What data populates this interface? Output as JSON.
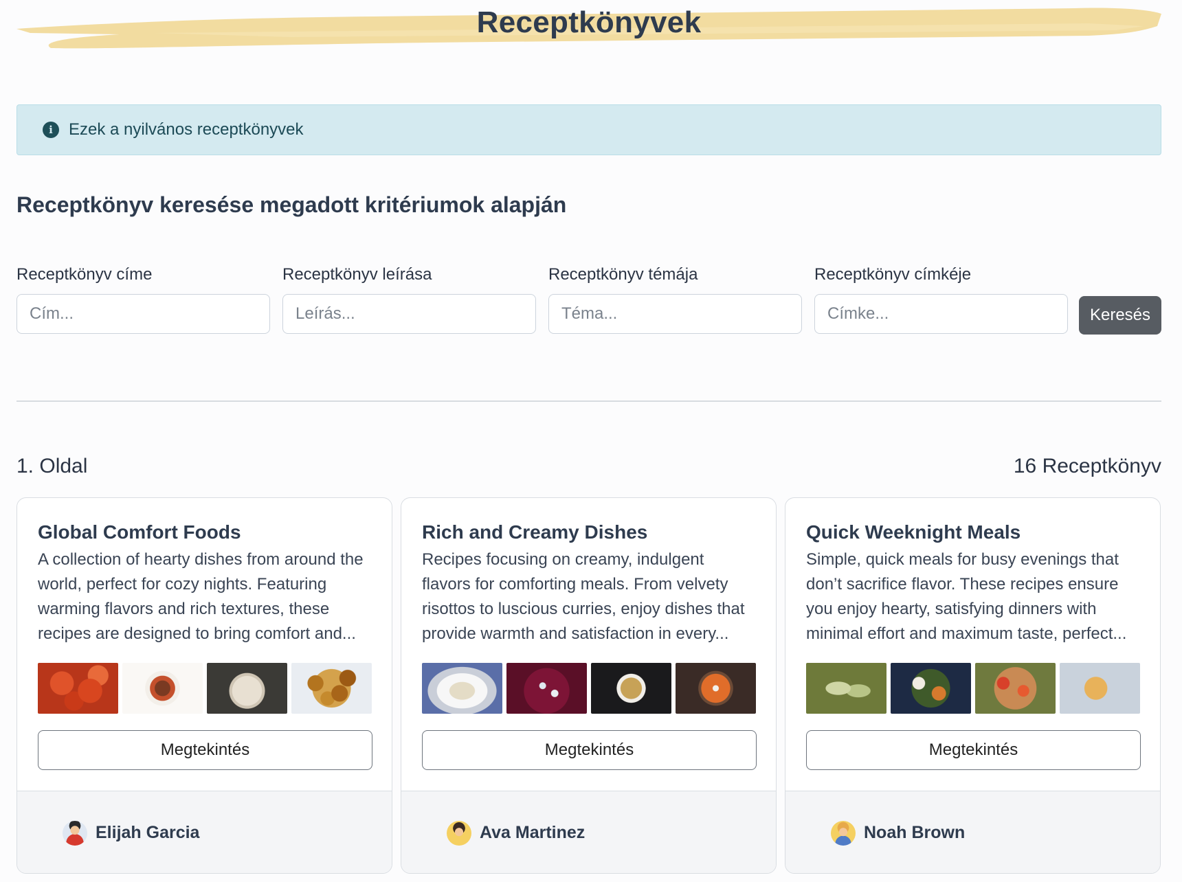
{
  "page": {
    "title": "Receptkönyvek"
  },
  "alert": {
    "text": "Ezek a nyilvános receptkönyvek",
    "icon": "info-icon"
  },
  "search": {
    "heading": "Receptkönyv keresése megadott kritériumok alapján",
    "fields": [
      {
        "label": "Receptkönyv címe",
        "placeholder": "Cím...",
        "value": ""
      },
      {
        "label": "Receptkönyv leírása",
        "placeholder": "Leírás...",
        "value": ""
      },
      {
        "label": "Receptkönyv témája",
        "placeholder": "Téma...",
        "value": ""
      },
      {
        "label": "Receptkönyv címkéje",
        "placeholder": "Címke...",
        "value": ""
      }
    ],
    "button_label": "Keresés"
  },
  "results": {
    "page_label": "1. Oldal",
    "count_label": "16 Receptkönyv"
  },
  "cards": [
    {
      "title": "Global Comfort Foods",
      "description": "A collection of hearty dishes from around the world, perfect for cozy nights. Featuring warming flavors and rich textures, these recipes are designed to bring comfort and...",
      "button_label": "Megtekintés",
      "author": "Elijah Garcia"
    },
    {
      "title": "Rich and Creamy Dishes",
      "description": "Recipes focusing on creamy, indulgent flavors for comforting meals. From velvety risottos to luscious curries, enjoy dishes that provide warmth and satisfaction in every...",
      "button_label": "Megtekintés",
      "author": "Ava Martinez"
    },
    {
      "title": "Quick Weeknight Meals",
      "description": "Simple, quick meals for busy evenings that don’t sacrifice flavor. These recipes ensure you enjoy hearty, satisfying dinners with minimal effort and maximum taste, perfect...",
      "button_label": "Megtekintés",
      "author": "Noah Brown"
    }
  ],
  "colors": {
    "brush": "#f2dca0",
    "alert_bg": "#d4eaf0",
    "search_button": "#575c62",
    "title_text": "#2e3b4e"
  }
}
